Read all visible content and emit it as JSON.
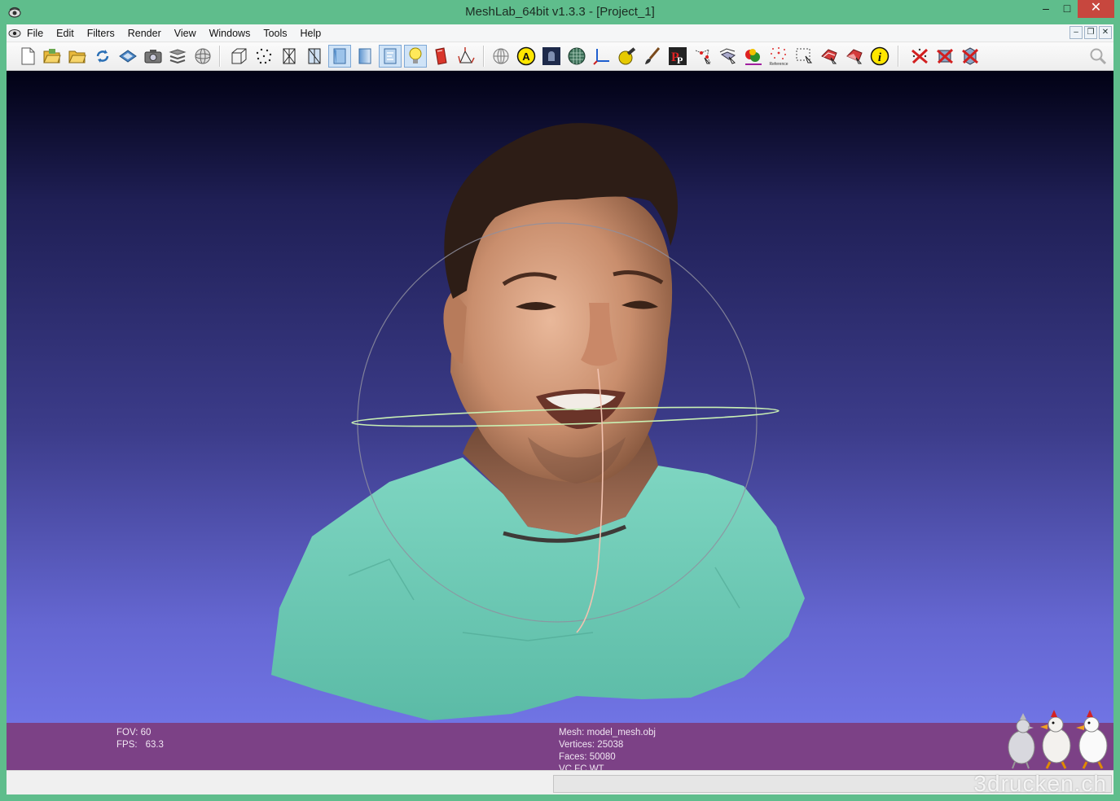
{
  "window": {
    "title": "MeshLab_64bit v1.3.3 - [Project_1]",
    "frame_color": "#5fbd8c",
    "controls": {
      "minimize": "–",
      "maximize": "□",
      "close": "✕"
    }
  },
  "menubar": {
    "items": [
      "File",
      "Edit",
      "Filters",
      "Render",
      "View",
      "Windows",
      "Tools",
      "Help"
    ],
    "mdi_controls": {
      "minimize": "–",
      "restore": "❐",
      "close": "✕"
    }
  },
  "toolbar": {
    "icons": [
      "new-document-icon",
      "open-folder-icon",
      "open-project-icon",
      "reload-icon",
      "save-icon",
      "snapshot-icon",
      "layers-icon",
      "sphere-grid-icon",
      "bounding-box-icon",
      "points-icon",
      "wireframe-icon",
      "hidden-lines-icon",
      "flat-shading-icon",
      "smooth-shading-icon",
      "texture-icon",
      "light-icon",
      "color-texture-icon",
      "vertex-normals-icon",
      "globe-icon",
      "annotation-a-icon",
      "quality-icon",
      "sphere-mesh-icon",
      "axes-icon",
      "measure-icon",
      "paint-brush-icon",
      "pickpoints-icon",
      "select-vertices-icon",
      "align-icon",
      "mutual-info-icon",
      "reference-icon",
      "select-faces-icon",
      "select-connected-icon",
      "select-region-icon",
      "info-icon",
      "delete-vertices-icon",
      "delete-faces-icon",
      "delete-faces-vertices-icon",
      "search-icon"
    ],
    "reference_label": "Reference"
  },
  "info": {
    "fov": "FOV: 60",
    "fps_label": "FPS:",
    "fps_value": "63.3",
    "mesh": "Mesh: model_mesh.obj",
    "vertices": "Vertices: 25038",
    "faces": "Faces: 50080",
    "flags": "VC FC WT"
  },
  "watermark": "3drucken.ch",
  "colors": {
    "info_bar": "#7c4186",
    "viewport_top": "#010114",
    "viewport_bottom": "#7074e4",
    "close_button": "#c7473e"
  }
}
